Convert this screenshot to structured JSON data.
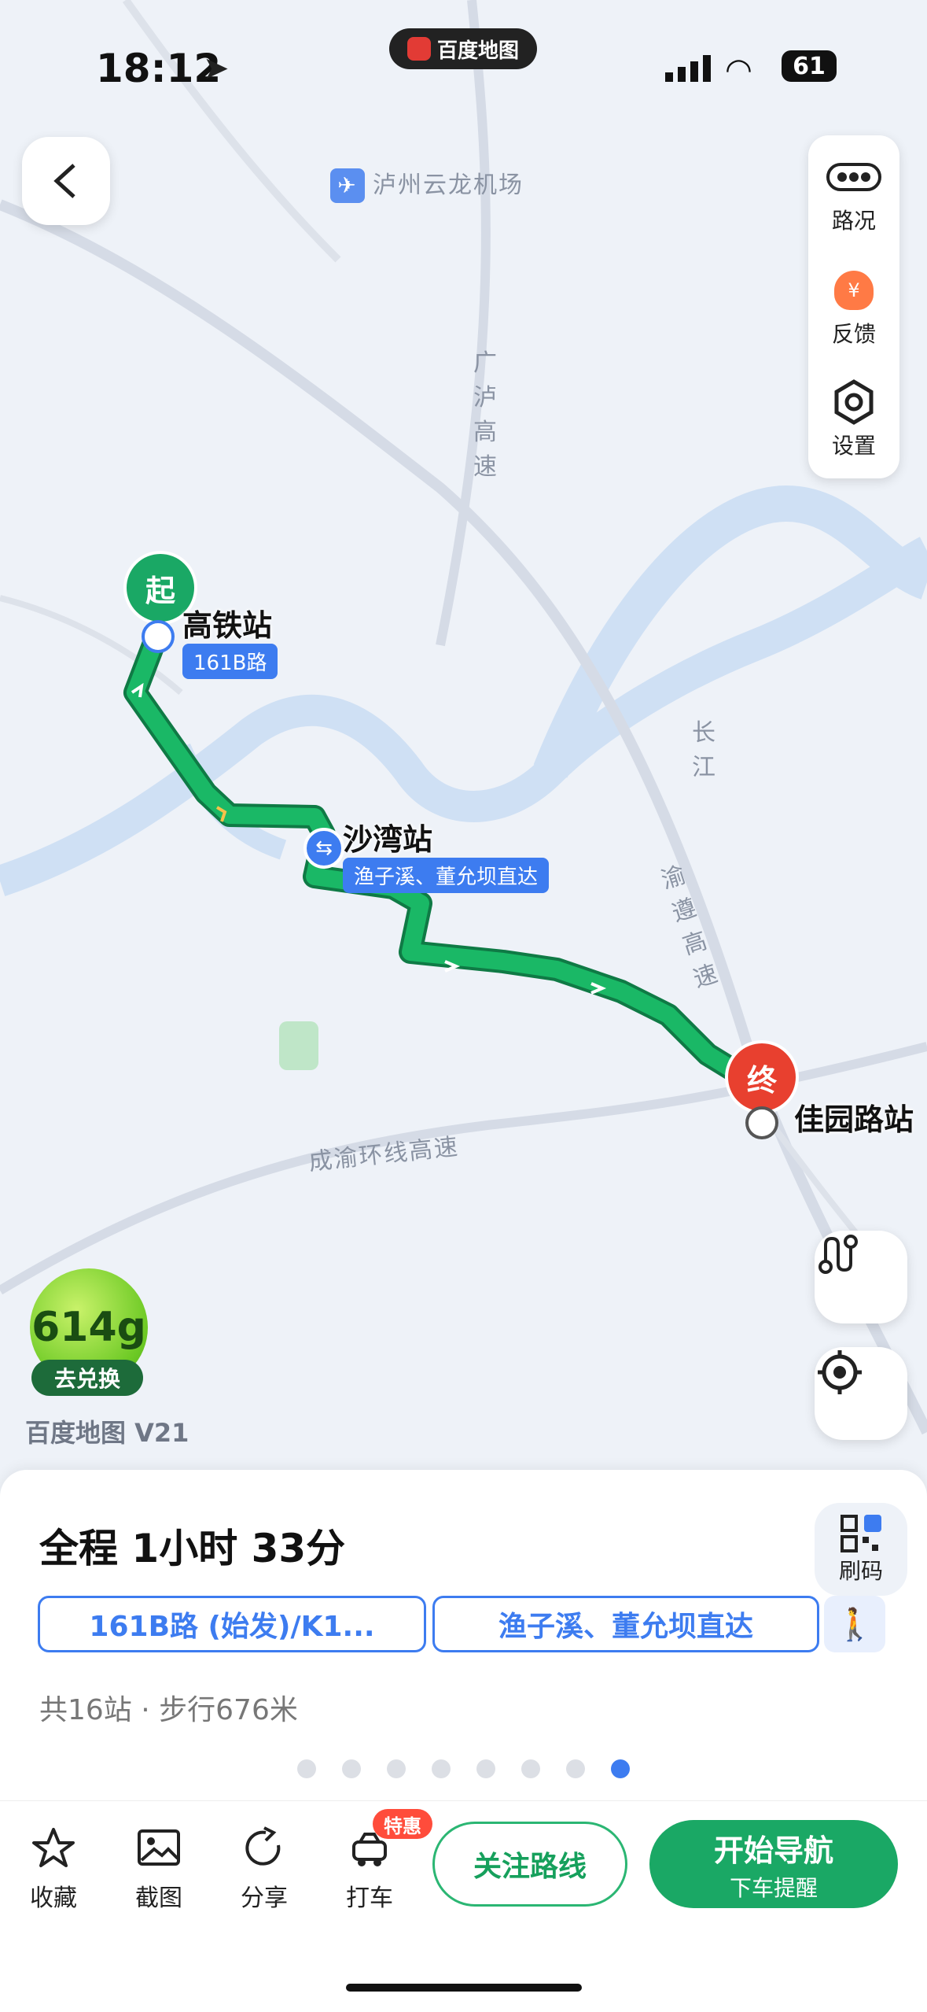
{
  "status": {
    "time": "18:12",
    "brand": "百度地图",
    "battery": "61"
  },
  "map": {
    "labels": {
      "airport": "泸州云龙机场",
      "hwy_north": "广泸高速",
      "river": "长江",
      "hwy_east": "渝遵高速",
      "hwy_ring": "成渝环线高速"
    },
    "start": {
      "pin": "起",
      "station": "高铁站",
      "line": "161B路"
    },
    "transfer": {
      "station": "沙湾站",
      "line": "渔子溪、董允坝直达"
    },
    "end": {
      "pin": "终",
      "station": "佳园路站"
    },
    "eco": {
      "points": "614g",
      "button": "去兑换"
    },
    "watermark": "百度地图 V21"
  },
  "tools": [
    {
      "label": "路况",
      "icon": "traffic-icon"
    },
    {
      "label": "反馈",
      "icon": "feedback-icon"
    },
    {
      "label": "设置",
      "icon": "settings-icon"
    }
  ],
  "route": {
    "duration": "全程 1小时 33分",
    "qr_label": "刷码",
    "segments": [
      "161B路 (始发)/K1...",
      "渔子溪、董允坝直达"
    ],
    "meta": "共16站 · 步行676米",
    "page_count": 8,
    "active_page": 8
  },
  "actions": {
    "favorite": "收藏",
    "screenshot": "截图",
    "share": "分享",
    "taxi": "打车",
    "deal_badge": "特惠",
    "follow": "关注路线",
    "nav_title": "开始导航",
    "nav_sub": "下车提醒"
  },
  "colors": {
    "route": "#1aa865",
    "accent": "#3d7cf0",
    "end_pin": "#e8402f"
  }
}
